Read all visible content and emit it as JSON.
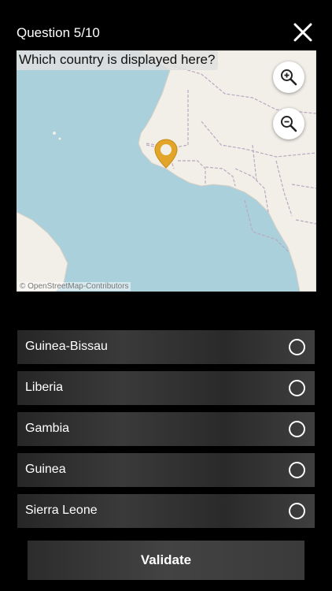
{
  "header": {
    "title": "Question 5/10",
    "close_icon": "close-icon"
  },
  "map": {
    "question": "Which country is displayed here?",
    "attribution": "© OpenStreetMap-Contributors",
    "zoom_in_icon": "zoom-in-icon",
    "zoom_out_icon": "zoom-out-icon",
    "pin_icon": "map-pin-icon",
    "colors": {
      "water": "#aad0dc",
      "land": "#f2efe9",
      "border": "#b9a9c0",
      "pin": "#e2a52a"
    }
  },
  "answers": [
    {
      "label": "Guinea-Bissau"
    },
    {
      "label": "Liberia"
    },
    {
      "label": "Gambia"
    },
    {
      "label": "Guinea"
    },
    {
      "label": "Sierra Leone"
    }
  ],
  "validate_label": "Validate"
}
